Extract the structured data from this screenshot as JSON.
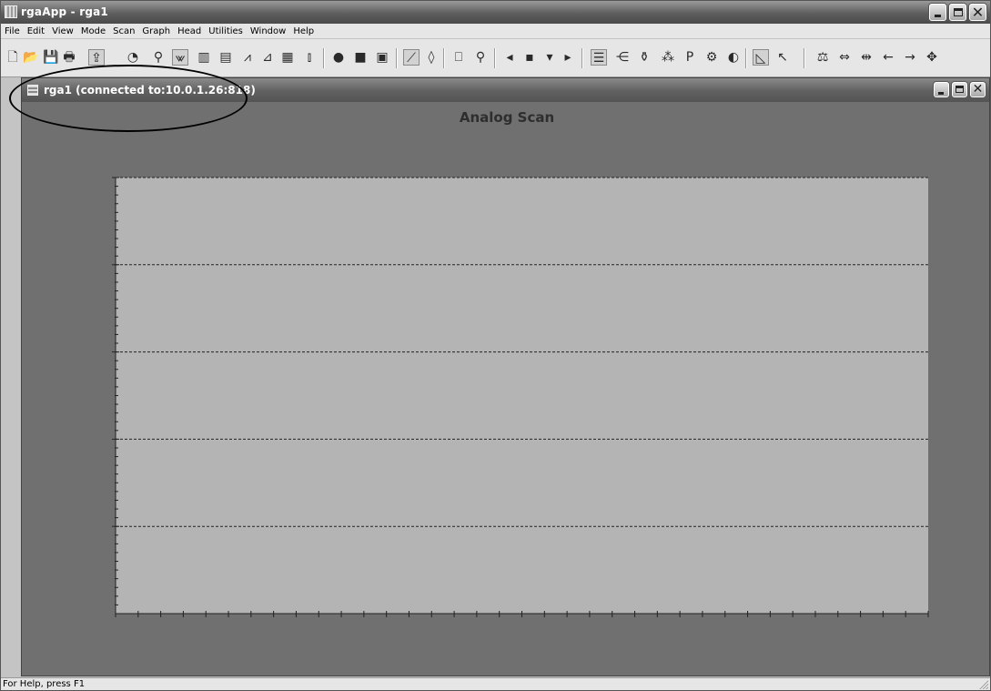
{
  "app": {
    "title": "rgaApp - rga1"
  },
  "menu": [
    {
      "id": "file",
      "label": "File"
    },
    {
      "id": "edit",
      "label": "Edit"
    },
    {
      "id": "view",
      "label": "View"
    },
    {
      "id": "mode",
      "label": "Mode"
    },
    {
      "id": "scan",
      "label": "Scan"
    },
    {
      "id": "graph",
      "label": "Graph"
    },
    {
      "id": "head",
      "label": "Head"
    },
    {
      "id": "utilities",
      "label": "Utilities"
    },
    {
      "id": "window",
      "label": "Window"
    },
    {
      "id": "help",
      "label": "Help"
    }
  ],
  "toolbar": {
    "icons": [
      "new-file-icon",
      "open-folder-icon",
      "save-icon",
      "print-icon",
      "upload-icon",
      "timer-icon",
      "probe-icon",
      "analog-mode-icon",
      "histogram-mode-icon",
      "table-mode-icon",
      "pressure-trend-icon",
      "leak-check-icon",
      "table-icon",
      "spectrum-icon",
      "go-scan-icon",
      "stop-scan-icon",
      "single-scan-icon",
      "autoscale-icon",
      "zoom-fit-icon",
      "library-icon",
      "zoom-icon",
      "prev-icon",
      "mass-icon",
      "dropdown-icon",
      "next-icon",
      "filament-icon",
      "cem-icon",
      "degas-icon",
      "sensitivity-icon",
      "pressure-icon",
      "settings-icon",
      "head-icon",
      "cursor-icon",
      "help-pointer-icon",
      "balance-icon",
      "expand-icon",
      "compress-icon",
      "arrow-left-icon",
      "arrow-right-icon",
      "move-icon"
    ]
  },
  "child": {
    "title": "rga1 (connected to:10.0.1.26:818)"
  },
  "chart_data": {
    "type": "line",
    "title": "Analog Scan",
    "series": [],
    "grid": true,
    "y_major_divisions": 5,
    "x_major_divisions": 36
  },
  "status": {
    "text": "For Help, press F1"
  },
  "colors": {
    "plot_background": "#b4b4b4",
    "window_background": "#707070",
    "title_bar": "#5e5e5e"
  }
}
